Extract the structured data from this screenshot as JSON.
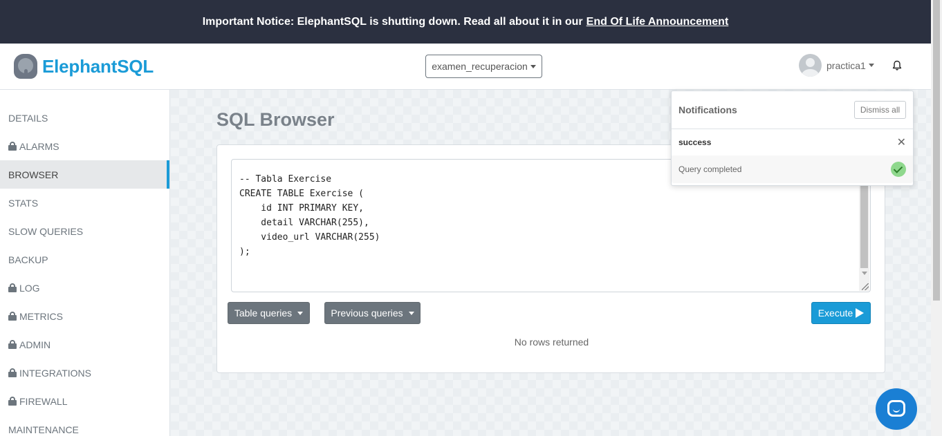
{
  "notice": {
    "text": "Important Notice: ElephantSQL is shutting down. Read all about it in our",
    "link": "End Of Life Announcement"
  },
  "header": {
    "brand": "ElephantSQL",
    "instance": "examen_recuperacion",
    "username": "practica1"
  },
  "sidebar": {
    "items": [
      {
        "label": "DETAILS",
        "locked": false,
        "active": false
      },
      {
        "label": "ALARMS",
        "locked": true,
        "active": false
      },
      {
        "label": "BROWSER",
        "locked": false,
        "active": true
      },
      {
        "label": "STATS",
        "locked": false,
        "active": false
      },
      {
        "label": "SLOW QUERIES",
        "locked": false,
        "active": false
      },
      {
        "label": "BACKUP",
        "locked": false,
        "active": false
      },
      {
        "label": "LOG",
        "locked": true,
        "active": false
      },
      {
        "label": "METRICS",
        "locked": true,
        "active": false
      },
      {
        "label": "ADMIN",
        "locked": true,
        "active": false
      },
      {
        "label": "INTEGRATIONS",
        "locked": true,
        "active": false
      },
      {
        "label": "FIREWALL",
        "locked": true,
        "active": false
      },
      {
        "label": "MAINTENANCE",
        "locked": false,
        "active": false
      }
    ]
  },
  "main": {
    "title": "SQL Browser",
    "query": "-- Tabla Exercise\nCREATE TABLE Exercise (\n    id INT PRIMARY KEY,\n    detail VARCHAR(255),\n    video_url VARCHAR(255)\n);",
    "table_queries_label": "Table queries",
    "previous_queries_label": "Previous queries",
    "execute_label": "Execute",
    "result_text": "No rows returned"
  },
  "notifications": {
    "title": "Notifications",
    "dismiss_label": "Dismiss all",
    "items": [
      {
        "kind": "success",
        "message": "Query completed"
      }
    ]
  },
  "colors": {
    "accent": "#1a9bd7",
    "notice_bg": "#2b3040",
    "success": "#8fd88d"
  }
}
